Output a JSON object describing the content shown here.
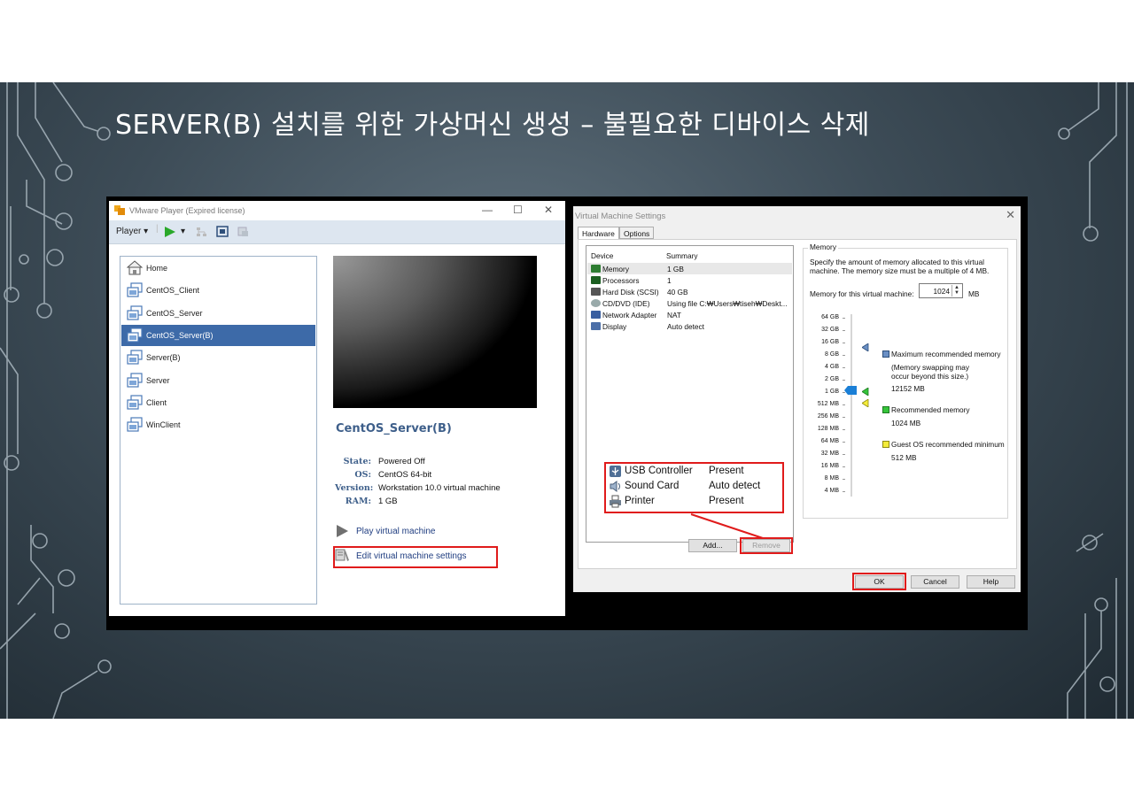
{
  "slide": {
    "title": "SERVER(B) 설치를 위한 가상머신 생성 – 불필요한 디바이스 삭제"
  },
  "player_window": {
    "title": "VMware Player (Expired license)",
    "menu_label": "Player",
    "library": [
      {
        "label": "Home",
        "selected": false
      },
      {
        "label": "CentOS_Client",
        "selected": false
      },
      {
        "label": "CentOS_Server",
        "selected": false
      },
      {
        "label": "CentOS_Server(B)",
        "selected": true
      },
      {
        "label": "Server(B)",
        "selected": false
      },
      {
        "label": "Server",
        "selected": false
      },
      {
        "label": "Client",
        "selected": false
      },
      {
        "label": "WinClient",
        "selected": false
      }
    ],
    "vm_name": "CentOS_Server(B)",
    "details": [
      {
        "key": "State:",
        "value": "Powered Off"
      },
      {
        "key": "OS:",
        "value": "CentOS 64-bit"
      },
      {
        "key": "Version:",
        "value": "Workstation 10.0 virtual machine"
      },
      {
        "key": "RAM:",
        "value": "1 GB"
      }
    ],
    "actions": {
      "play": "Play virtual machine",
      "edit": "Edit virtual machine settings"
    }
  },
  "settings_dialog": {
    "title": "Virtual Machine Settings",
    "tabs": [
      {
        "label": "Hardware",
        "active": true
      },
      {
        "label": "Options",
        "active": false
      }
    ],
    "device_headers": {
      "device": "Device",
      "summary": "Summary"
    },
    "devices": [
      {
        "name": "Memory",
        "summary": "1 GB",
        "icon": "memory-icon",
        "selected": true
      },
      {
        "name": "Processors",
        "summary": "1",
        "icon": "cpu-icon",
        "selected": false
      },
      {
        "name": "Hard Disk (SCSI)",
        "summary": "40 GB",
        "icon": "disk-icon",
        "selected": false
      },
      {
        "name": "CD/DVD (IDE)",
        "summary": "Using file C:₩Users₩tiseh₩Deskt...",
        "icon": "cd-icon",
        "selected": false
      },
      {
        "name": "Network Adapter",
        "summary": "NAT",
        "icon": "network-icon",
        "selected": false
      },
      {
        "name": "Display",
        "summary": "Auto detect",
        "icon": "display-icon",
        "selected": false
      }
    ],
    "highlighted_devices": [
      {
        "name": "USB Controller",
        "summary": "Present",
        "icon": "usb-icon"
      },
      {
        "name": "Sound Card",
        "summary": "Auto detect",
        "icon": "speaker-icon"
      },
      {
        "name": "Printer",
        "summary": "Present",
        "icon": "printer-icon"
      }
    ],
    "buttons": {
      "add": "Add...",
      "remove": "Remove",
      "ok": "OK",
      "cancel": "Cancel",
      "help": "Help"
    },
    "memory": {
      "group_title": "Memory",
      "description": "Specify the amount of memory allocated to this virtual machine. The memory size must be a multiple of 4 MB.",
      "field_label": "Memory for this virtual machine:",
      "value": "1024",
      "unit": "MB",
      "scale": [
        "64 GB",
        "32 GB",
        "16 GB",
        "8 GB",
        "4 GB",
        "2 GB",
        "1 GB",
        "512 MB",
        "256 MB",
        "128 MB",
        "64 MB",
        "32 MB",
        "16 MB",
        "8 MB",
        "4 MB"
      ],
      "legend": {
        "max_label": "Maximum recommended memory",
        "max_note": "(Memory swapping may occur beyond this size.)",
        "max_value": "12152 MB",
        "rec_label": "Recommended memory",
        "rec_value": "1024 MB",
        "min_label": "Guest OS recommended minimum",
        "min_value": "512 MB"
      }
    }
  },
  "colors": {
    "highlight_red": "#e01b1b",
    "selection_blue": "#3d6aa8",
    "link_blue": "#1f3d80"
  }
}
